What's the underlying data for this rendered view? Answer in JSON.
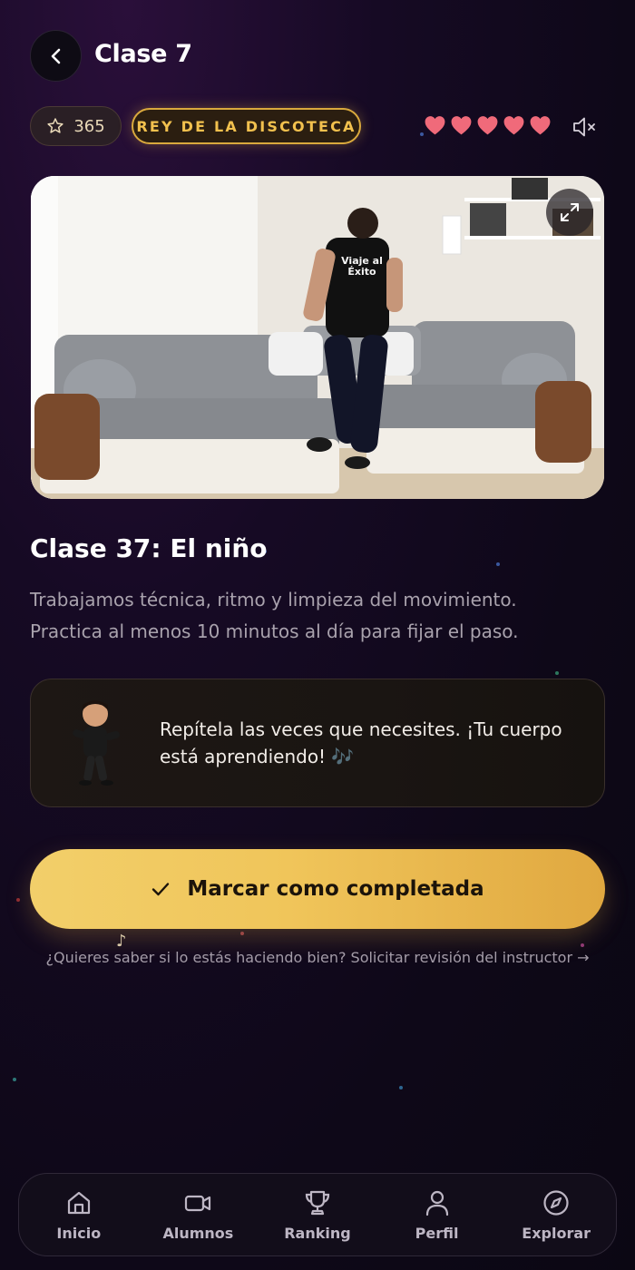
{
  "header": {
    "title": "Clase 7"
  },
  "stats": {
    "stars": "365",
    "rank": "REY DE LA DISCOTECA",
    "lives": 5,
    "colors": {
      "heart": "#f06a7a",
      "gold": "#f2c14e"
    }
  },
  "video": {
    "shirt_text": "Viaje al Éxito"
  },
  "lesson": {
    "title": "Clase 37: El niño",
    "description": "Trabajamos técnica, ritmo y limpieza del movimiento. Practica al menos 10 minutos al día para fijar el paso."
  },
  "coach": {
    "message": "Repítela las veces que necesites. ¡Tu cuerpo está aprendiendo! 🎶"
  },
  "actions": {
    "complete_label": "Marcar como completada",
    "review_link": "¿Quieres saber si lo estás haciendo bien? Solicitar revisión del instructor →"
  },
  "nav": {
    "items": [
      {
        "label": "Inicio",
        "icon": "home-icon"
      },
      {
        "label": "Alumnos",
        "icon": "video-camera-icon"
      },
      {
        "label": "Ranking",
        "icon": "trophy-icon"
      },
      {
        "label": "Perfil",
        "icon": "user-icon"
      },
      {
        "label": "Explorar",
        "icon": "compass-icon"
      }
    ]
  }
}
